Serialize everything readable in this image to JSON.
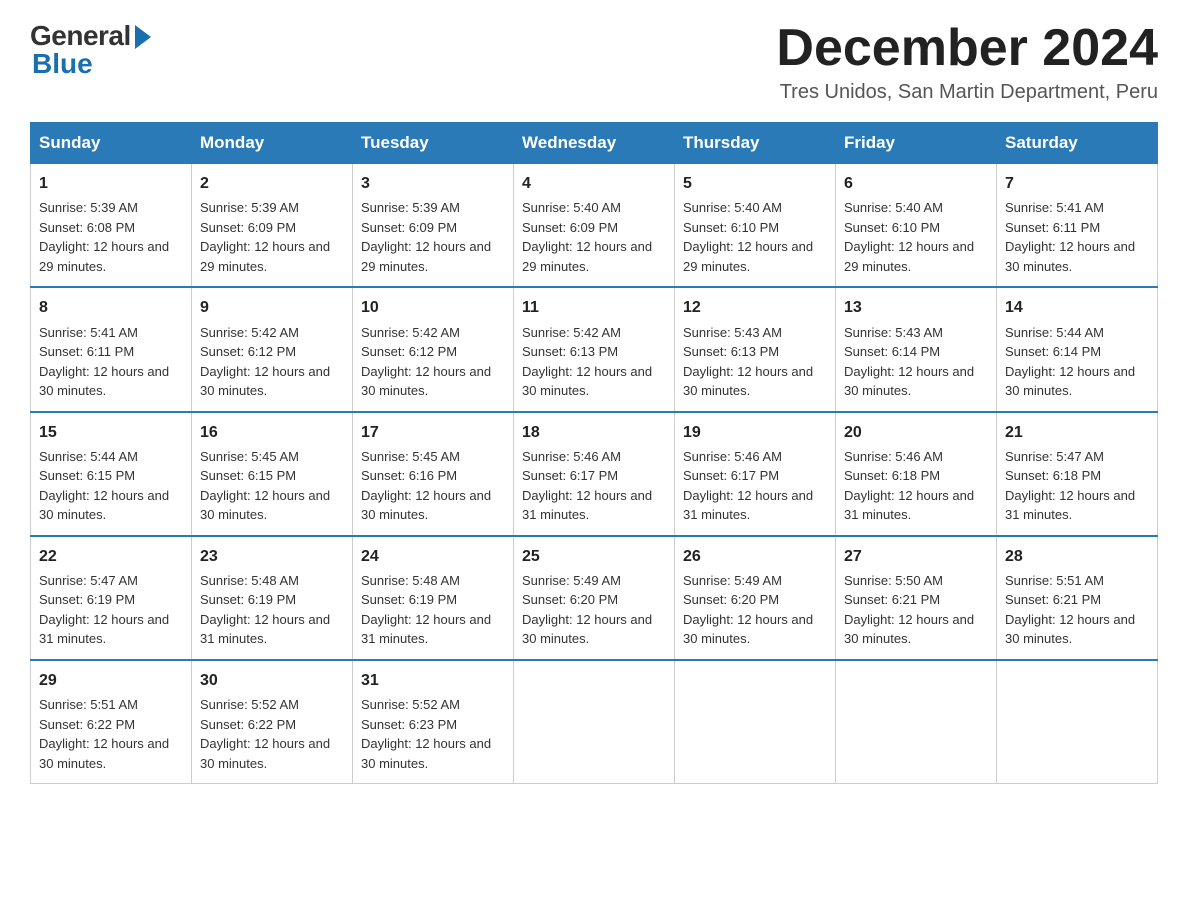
{
  "logo": {
    "general_text": "General",
    "blue_text": "Blue"
  },
  "header": {
    "month_year": "December 2024",
    "location": "Tres Unidos, San Martin Department, Peru"
  },
  "weekdays": [
    "Sunday",
    "Monday",
    "Tuesday",
    "Wednesday",
    "Thursday",
    "Friday",
    "Saturday"
  ],
  "weeks": [
    [
      {
        "day": "1",
        "sunrise": "5:39 AM",
        "sunset": "6:08 PM",
        "daylight": "12 hours and 29 minutes."
      },
      {
        "day": "2",
        "sunrise": "5:39 AM",
        "sunset": "6:09 PM",
        "daylight": "12 hours and 29 minutes."
      },
      {
        "day": "3",
        "sunrise": "5:39 AM",
        "sunset": "6:09 PM",
        "daylight": "12 hours and 29 minutes."
      },
      {
        "day": "4",
        "sunrise": "5:40 AM",
        "sunset": "6:09 PM",
        "daylight": "12 hours and 29 minutes."
      },
      {
        "day": "5",
        "sunrise": "5:40 AM",
        "sunset": "6:10 PM",
        "daylight": "12 hours and 29 minutes."
      },
      {
        "day": "6",
        "sunrise": "5:40 AM",
        "sunset": "6:10 PM",
        "daylight": "12 hours and 29 minutes."
      },
      {
        "day": "7",
        "sunrise": "5:41 AM",
        "sunset": "6:11 PM",
        "daylight": "12 hours and 30 minutes."
      }
    ],
    [
      {
        "day": "8",
        "sunrise": "5:41 AM",
        "sunset": "6:11 PM",
        "daylight": "12 hours and 30 minutes."
      },
      {
        "day": "9",
        "sunrise": "5:42 AM",
        "sunset": "6:12 PM",
        "daylight": "12 hours and 30 minutes."
      },
      {
        "day": "10",
        "sunrise": "5:42 AM",
        "sunset": "6:12 PM",
        "daylight": "12 hours and 30 minutes."
      },
      {
        "day": "11",
        "sunrise": "5:42 AM",
        "sunset": "6:13 PM",
        "daylight": "12 hours and 30 minutes."
      },
      {
        "day": "12",
        "sunrise": "5:43 AM",
        "sunset": "6:13 PM",
        "daylight": "12 hours and 30 minutes."
      },
      {
        "day": "13",
        "sunrise": "5:43 AM",
        "sunset": "6:14 PM",
        "daylight": "12 hours and 30 minutes."
      },
      {
        "day": "14",
        "sunrise": "5:44 AM",
        "sunset": "6:14 PM",
        "daylight": "12 hours and 30 minutes."
      }
    ],
    [
      {
        "day": "15",
        "sunrise": "5:44 AM",
        "sunset": "6:15 PM",
        "daylight": "12 hours and 30 minutes."
      },
      {
        "day": "16",
        "sunrise": "5:45 AM",
        "sunset": "6:15 PM",
        "daylight": "12 hours and 30 minutes."
      },
      {
        "day": "17",
        "sunrise": "5:45 AM",
        "sunset": "6:16 PM",
        "daylight": "12 hours and 30 minutes."
      },
      {
        "day": "18",
        "sunrise": "5:46 AM",
        "sunset": "6:17 PM",
        "daylight": "12 hours and 31 minutes."
      },
      {
        "day": "19",
        "sunrise": "5:46 AM",
        "sunset": "6:17 PM",
        "daylight": "12 hours and 31 minutes."
      },
      {
        "day": "20",
        "sunrise": "5:46 AM",
        "sunset": "6:18 PM",
        "daylight": "12 hours and 31 minutes."
      },
      {
        "day": "21",
        "sunrise": "5:47 AM",
        "sunset": "6:18 PM",
        "daylight": "12 hours and 31 minutes."
      }
    ],
    [
      {
        "day": "22",
        "sunrise": "5:47 AM",
        "sunset": "6:19 PM",
        "daylight": "12 hours and 31 minutes."
      },
      {
        "day": "23",
        "sunrise": "5:48 AM",
        "sunset": "6:19 PM",
        "daylight": "12 hours and 31 minutes."
      },
      {
        "day": "24",
        "sunrise": "5:48 AM",
        "sunset": "6:19 PM",
        "daylight": "12 hours and 31 minutes."
      },
      {
        "day": "25",
        "sunrise": "5:49 AM",
        "sunset": "6:20 PM",
        "daylight": "12 hours and 30 minutes."
      },
      {
        "day": "26",
        "sunrise": "5:49 AM",
        "sunset": "6:20 PM",
        "daylight": "12 hours and 30 minutes."
      },
      {
        "day": "27",
        "sunrise": "5:50 AM",
        "sunset": "6:21 PM",
        "daylight": "12 hours and 30 minutes."
      },
      {
        "day": "28",
        "sunrise": "5:51 AM",
        "sunset": "6:21 PM",
        "daylight": "12 hours and 30 minutes."
      }
    ],
    [
      {
        "day": "29",
        "sunrise": "5:51 AM",
        "sunset": "6:22 PM",
        "daylight": "12 hours and 30 minutes."
      },
      {
        "day": "30",
        "sunrise": "5:52 AM",
        "sunset": "6:22 PM",
        "daylight": "12 hours and 30 minutes."
      },
      {
        "day": "31",
        "sunrise": "5:52 AM",
        "sunset": "6:23 PM",
        "daylight": "12 hours and 30 minutes."
      },
      null,
      null,
      null,
      null
    ]
  ]
}
